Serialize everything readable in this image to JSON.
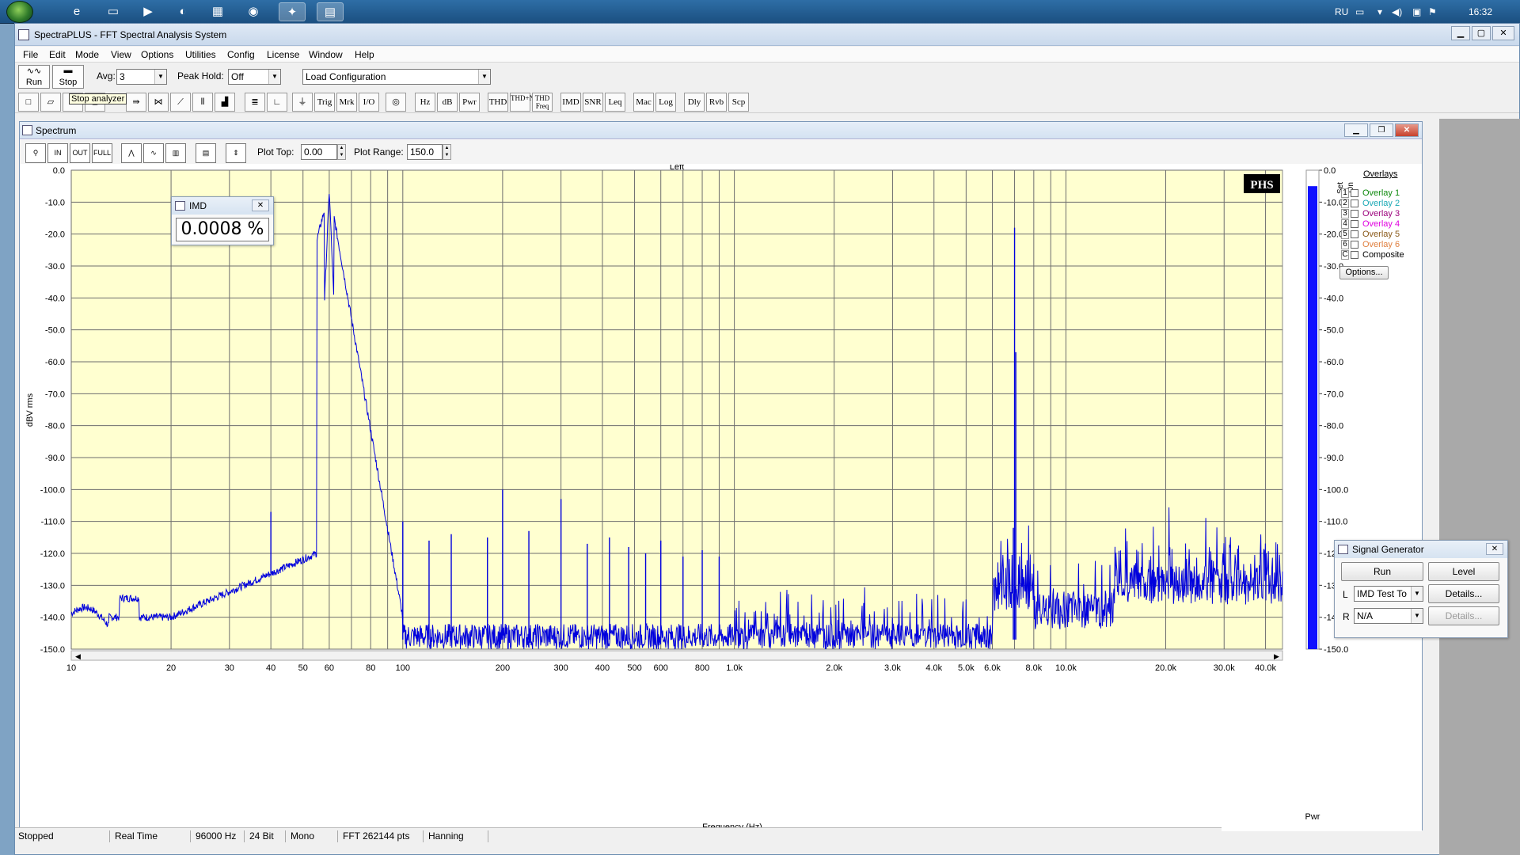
{
  "taskbar": {
    "lang": "RU",
    "clock": "16:32"
  },
  "app": {
    "title": "SpectraPLUS - FFT Spectral Analysis System"
  },
  "menu": [
    "File",
    "Edit",
    "Mode",
    "View",
    "Options",
    "Utilities",
    "Config",
    "License",
    "Window",
    "Help"
  ],
  "toolbar": {
    "run_label": "Run",
    "stop_label": "Stop",
    "tooltip": "Stop analyzer",
    "avg_label": "Avg:",
    "avg_value": "3",
    "peak_hold_label": "Peak Hold:",
    "peak_hold_value": "Off",
    "config_value": "Load Configuration",
    "buttons": [
      "Trig",
      "Mrk",
      "I/O",
      "Hz",
      "dB",
      "Pwr",
      "THD",
      "THD+N",
      "THD Freq",
      "IMD",
      "SNR",
      "Leq",
      "Mac",
      "Log",
      "Dly",
      "Rvb",
      "Scp"
    ]
  },
  "spectrum": {
    "title": "Spectrum",
    "plot_top_label": "Plot Top:",
    "plot_top_value": "0.00",
    "plot_range_label": "Plot Range:",
    "plot_range_value": "150.0",
    "channel": "Left",
    "logo": "PHS",
    "bar_label": "Pwr",
    "bar_level_db": -5
  },
  "chart_data": {
    "type": "line",
    "channel": "Left",
    "xlabel": "Frequency (Hz)",
    "ylabel": "dBV rms",
    "x_scale": "log",
    "xlim": [
      10,
      45000
    ],
    "ylim": [
      -150,
      0
    ],
    "x_ticks": [
      {
        "v": 10,
        "label": "10"
      },
      {
        "v": 20,
        "label": "20"
      },
      {
        "v": 30,
        "label": "30"
      },
      {
        "v": 40,
        "label": "40"
      },
      {
        "v": 50,
        "label": "50"
      },
      {
        "v": 60,
        "label": "60"
      },
      {
        "v": 80,
        "label": "80"
      },
      {
        "v": 100,
        "label": "100"
      },
      {
        "v": 200,
        "label": "200"
      },
      {
        "v": 300,
        "label": "300"
      },
      {
        "v": 400,
        "label": "400"
      },
      {
        "v": 500,
        "label": "500"
      },
      {
        "v": 600,
        "label": "600"
      },
      {
        "v": 800,
        "label": "800"
      },
      {
        "v": 1000,
        "label": "1.0k"
      },
      {
        "v": 2000,
        "label": "2.0k"
      },
      {
        "v": 3000,
        "label": "3.0k"
      },
      {
        "v": 4000,
        "label": "4.0k"
      },
      {
        "v": 5000,
        "label": "5.0k"
      },
      {
        "v": 6000,
        "label": "6.0k"
      },
      {
        "v": 8000,
        "label": "8.0k"
      },
      {
        "v": 10000,
        "label": "10.0k"
      },
      {
        "v": 20000,
        "label": "20.0k"
      },
      {
        "v": 30000,
        "label": "30.0k"
      },
      {
        "v": 40000,
        "label": "40.0k"
      }
    ],
    "y_ticks": [
      "0.0",
      "-10.0",
      "-20.0",
      "-30.0",
      "-40.0",
      "-50.0",
      "-60.0",
      "-70.0",
      "-80.0",
      "-90.0",
      "-100.0",
      "-110.0",
      "-120.0",
      "-130.0",
      "-140.0",
      "-150.0"
    ],
    "grid": true,
    "series": [
      {
        "color": "#0000dd",
        "peaks": [
          {
            "x": 40,
            "y": -107
          },
          {
            "x": 60,
            "y": -6
          },
          {
            "x": 100,
            "y": -110
          },
          {
            "x": 120,
            "y": -116
          },
          {
            "x": 140,
            "y": -114
          },
          {
            "x": 180,
            "y": -115
          },
          {
            "x": 200,
            "y": -100
          },
          {
            "x": 240,
            "y": -113
          },
          {
            "x": 300,
            "y": -103
          },
          {
            "x": 360,
            "y": -117
          },
          {
            "x": 420,
            "y": -115
          },
          {
            "x": 480,
            "y": -118
          },
          {
            "x": 540,
            "y": -120
          },
          {
            "x": 600,
            "y": -116
          },
          {
            "x": 700,
            "y": -121
          },
          {
            "x": 800,
            "y": -119
          },
          {
            "x": 900,
            "y": -121
          },
          {
            "x": 7000,
            "y": -18
          },
          {
            "x": 7060,
            "y": -57
          },
          {
            "x": 6940,
            "y": -112
          }
        ]
      }
    ]
  },
  "imd": {
    "title": "IMD",
    "value": "0.0008 %"
  },
  "overlays": {
    "header": "Overlays",
    "set_label": "Set",
    "on_label": "On",
    "items": [
      {
        "n": "1",
        "label": "Overlay 1",
        "color": "#0f8a0f"
      },
      {
        "n": "2",
        "label": "Overlay 2",
        "color": "#1aa9b5"
      },
      {
        "n": "3",
        "label": "Overlay 3",
        "color": "#9b007c"
      },
      {
        "n": "4",
        "label": "Overlay 4",
        "color": "#e000e0"
      },
      {
        "n": "5",
        "label": "Overlay 5",
        "color": "#8a5a1a"
      },
      {
        "n": "6",
        "label": "Overlay 6",
        "color": "#e08040"
      },
      {
        "n": "C",
        "label": "Composite",
        "color": "#000000"
      }
    ],
    "options_label": "Options..."
  },
  "signal_generator": {
    "title": "Signal Generator",
    "run_label": "Run",
    "level_label": "Level",
    "left_label": "L",
    "left_value": "IMD Test To",
    "left_details": "Details...",
    "right_label": "R",
    "right_value": "N/A",
    "right_details": "Details..."
  },
  "status": [
    "Stopped",
    "Real Time",
    "96000 Hz",
    "24 Bit",
    "Mono",
    "FFT 262144 pts",
    "Hanning"
  ]
}
